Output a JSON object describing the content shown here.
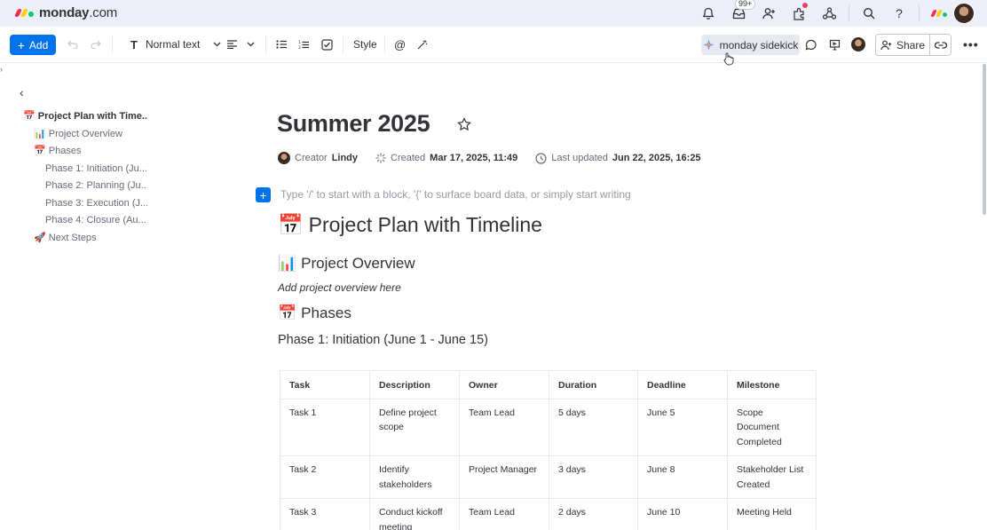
{
  "app": {
    "logo_text": "monday",
    "logo_suffix": ".com",
    "brand_colors": [
      "#f62b54",
      "#ffcc00",
      "#00ca72"
    ]
  },
  "topbar": {
    "inbox_badge": "99+",
    "icons": [
      "bell-icon",
      "inbox-icon",
      "invite-icon",
      "apps-icon",
      "integrations-icon",
      "search-icon",
      "help-icon",
      "monday-switcher-icon",
      "avatar"
    ]
  },
  "toolbar": {
    "add_label": "Add",
    "text_style_label": "Normal text",
    "style_label": "Style",
    "sidekick_label": "monday sidekick",
    "share_label": "Share"
  },
  "sidebar": {
    "items": [
      {
        "label": "📅 Project Plan with Time...",
        "level": 1
      },
      {
        "label": "📊 Project Overview",
        "level": 2
      },
      {
        "label": "📅 Phases",
        "level": 2
      },
      {
        "label": "Phase 1: Initiation (Ju...",
        "level": 3
      },
      {
        "label": "Phase 2: Planning (Ju...",
        "level": 3
      },
      {
        "label": "Phase 3: Execution (J...",
        "level": 3
      },
      {
        "label": "Phase 4: Closure (Au...",
        "level": 3
      },
      {
        "label": "🚀 Next Steps",
        "level": 2
      }
    ]
  },
  "doc": {
    "title": "Summer 2025",
    "meta": {
      "creator_label": "Creator",
      "creator_name": "Lindy",
      "created_label": "Created",
      "created_value": "Mar 17, 2025, 11:49",
      "updated_label": "Last updated",
      "updated_value": "Jun 22, 2025, 16:25"
    },
    "placeholder": "Type '/' to start with a block, '{' to surface board data, or simply start writing",
    "h1_emoji": "📅",
    "h1": "Project Plan with Timeline",
    "overview_emoji": "📊",
    "overview_heading": "Project Overview",
    "overview_note": "Add project overview here",
    "phases_emoji": "📅",
    "phases_heading": "Phases",
    "phase1_heading": "Phase 1: Initiation (June 1 - June 15)",
    "table": {
      "headers": [
        "Task",
        "Description",
        "Owner",
        "Duration",
        "Deadline",
        "Milestone"
      ],
      "rows": [
        [
          "Task 1",
          "Define project scope",
          "Team Lead",
          "5 days",
          "June 5",
          "Scope Document Completed"
        ],
        [
          "Task 2",
          "Identify stakeholders",
          "Project Manager",
          "3 days",
          "June 8",
          "Stakeholder List Created"
        ],
        [
          "Task 3",
          "Conduct kickoff meeting",
          "Team Lead",
          "2 days",
          "June 10",
          "Meeting Held"
        ]
      ]
    }
  }
}
